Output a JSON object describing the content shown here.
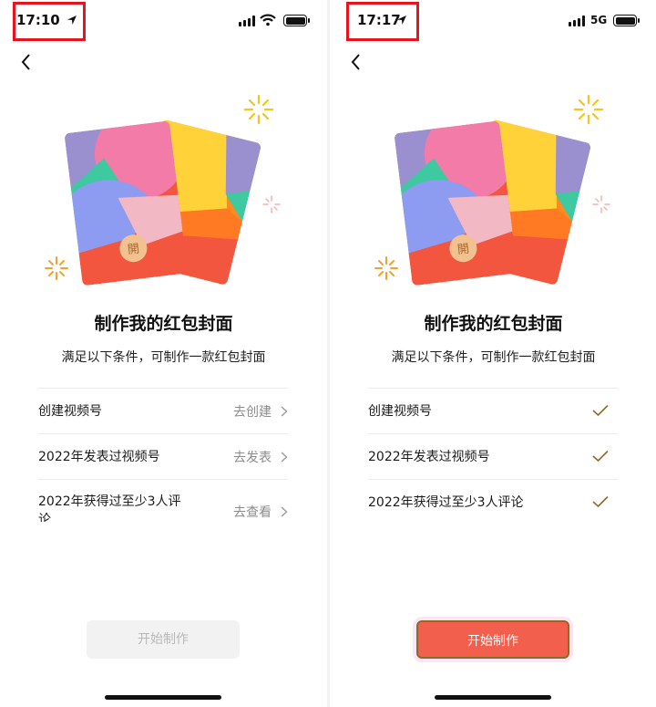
{
  "left": {
    "status": {
      "time": "17:10",
      "network": ""
    },
    "title": "制作我的红包封面",
    "subtitle": "满足以下条件，可制作一款红包封面",
    "conditions": [
      {
        "label": "创建视频号",
        "action": "去创建"
      },
      {
        "label": "2022年发表过视频号",
        "action": "去发表"
      },
      {
        "label": "2022年获得过至少3人评论",
        "action": "去查看"
      }
    ],
    "start_button": "开始制作"
  },
  "right": {
    "status": {
      "time": "17:17",
      "network": "5G"
    },
    "title": "制作我的红包封面",
    "subtitle": "满足以下条件，可制作一款红包封面",
    "conditions": [
      {
        "label": "创建视频号"
      },
      {
        "label": "2022年发表过视频号"
      },
      {
        "label": "2022年获得过至少3人评论"
      }
    ],
    "start_button": "开始制作"
  },
  "envelope_seal_char": "開",
  "colors": {
    "highlight": "#e8141b",
    "primary_button": "#f25f4c",
    "check": "#8c6a2a",
    "sparkle": "#f5c518"
  },
  "icons": [
    "location-arrow-icon",
    "signal-icon",
    "wifi-icon",
    "battery-icon",
    "back-chevron-icon",
    "chevron-right-icon",
    "checkmark-icon",
    "sparkle-icon"
  ]
}
